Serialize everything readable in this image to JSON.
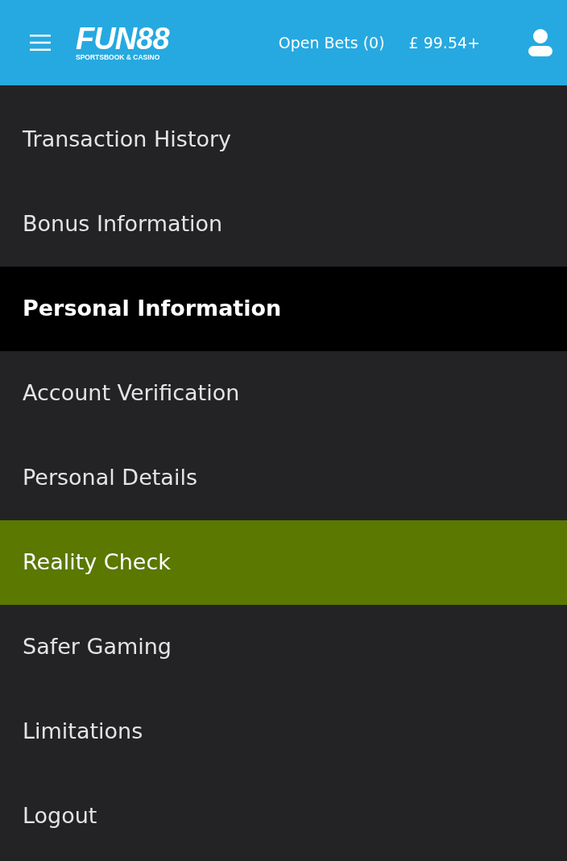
{
  "header": {
    "logo": {
      "name": "FUN88",
      "tagline": "SPORTSBOOK & CASINO"
    },
    "open_bets": "Open Bets (0)",
    "balance": "£ 99.54+"
  },
  "menu": [
    {
      "kind": "item",
      "label": "Transaction History",
      "selected": false
    },
    {
      "kind": "item",
      "label": "Bonus Information",
      "selected": false
    },
    {
      "kind": "header",
      "label": "Personal Information"
    },
    {
      "kind": "item",
      "label": "Account Verification",
      "selected": false
    },
    {
      "kind": "item",
      "label": "Personal Details",
      "selected": false
    },
    {
      "kind": "item",
      "label": "Reality Check",
      "selected": true
    },
    {
      "kind": "item",
      "label": "Safer Gaming",
      "selected": false
    },
    {
      "kind": "item",
      "label": "Limitations",
      "selected": false
    },
    {
      "kind": "item",
      "label": "Logout",
      "selected": false
    }
  ]
}
